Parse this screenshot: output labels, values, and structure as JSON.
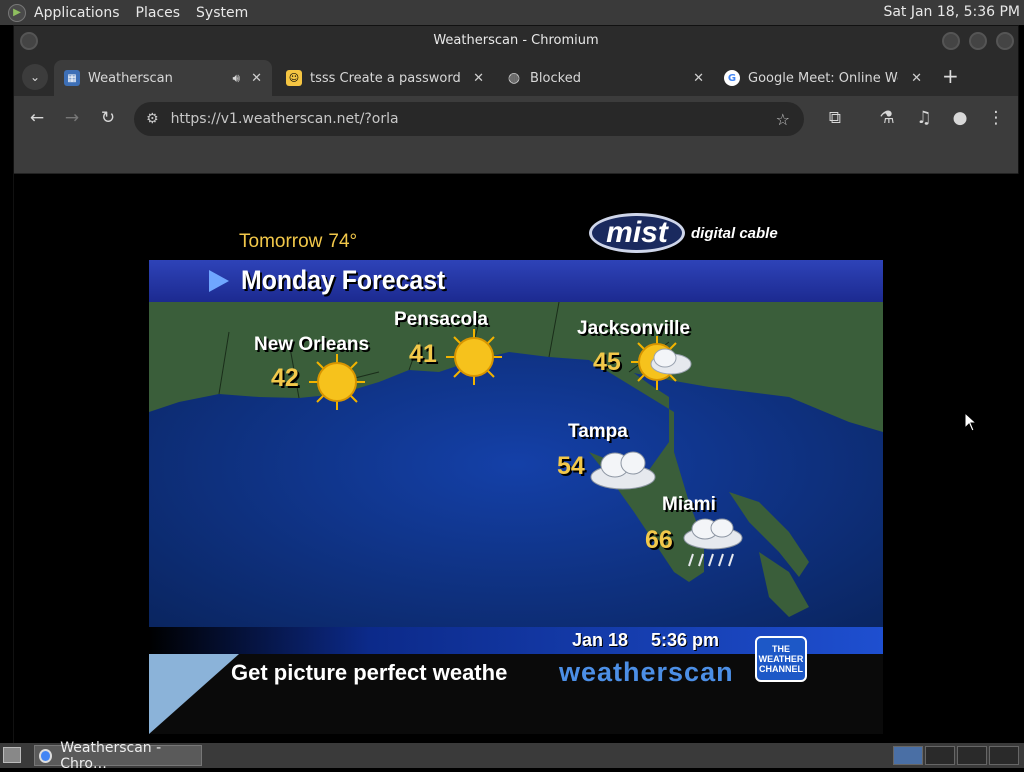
{
  "panel": {
    "menus": [
      "Applications",
      "Places",
      "System"
    ],
    "clock": "Sat Jan 18,  5:36 PM"
  },
  "window": {
    "title": "Weatherscan - Chromium"
  },
  "tabs": [
    {
      "label": "Weatherscan",
      "active": true,
      "audio": true,
      "favicon": "weatherscan-favicon"
    },
    {
      "label": "tsss Create a password-p",
      "active": false,
      "favicon": "emoji-favicon"
    },
    {
      "label": "Blocked",
      "active": false,
      "favicon": "globe-icon"
    },
    {
      "label": "Google Meet: Online Web",
      "active": false,
      "favicon": "google-icon"
    }
  ],
  "omnibox": {
    "url": "https://v1.weatherscan.net/?orla"
  },
  "weatherscan": {
    "tomorrow_label": "Tomorrow",
    "tomorrow_temp": "74°",
    "sponsor_word": "mist",
    "sponsor_sub": "digital cable",
    "banner_title": "Monday Forecast",
    "cities": [
      {
        "name": "New Orleans",
        "temp": "42",
        "condition": "sunny"
      },
      {
        "name": "Pensacola",
        "temp": "41",
        "condition": "sunny"
      },
      {
        "name": "Jacksonville",
        "temp": "45",
        "condition": "partly-cloudy"
      },
      {
        "name": "Tampa",
        "temp": "54",
        "condition": "cloudy"
      },
      {
        "name": "Miami",
        "temp": "66",
        "condition": "rain"
      }
    ],
    "date": "Jan 18",
    "time": "5:36 pm",
    "ticker": "Get picture perfect weathe",
    "brand": "weatherscan",
    "twc_logo": [
      "THE",
      "WEATHER",
      "CHANNEL"
    ]
  },
  "taskbar": {
    "task_label": "Weatherscan - Chro…"
  },
  "colors": {
    "accent_yellow": "#f2c84a",
    "banner_blue": "#2e43b8",
    "ocean": "#0d2b6e",
    "land": "#3a5e3a"
  }
}
